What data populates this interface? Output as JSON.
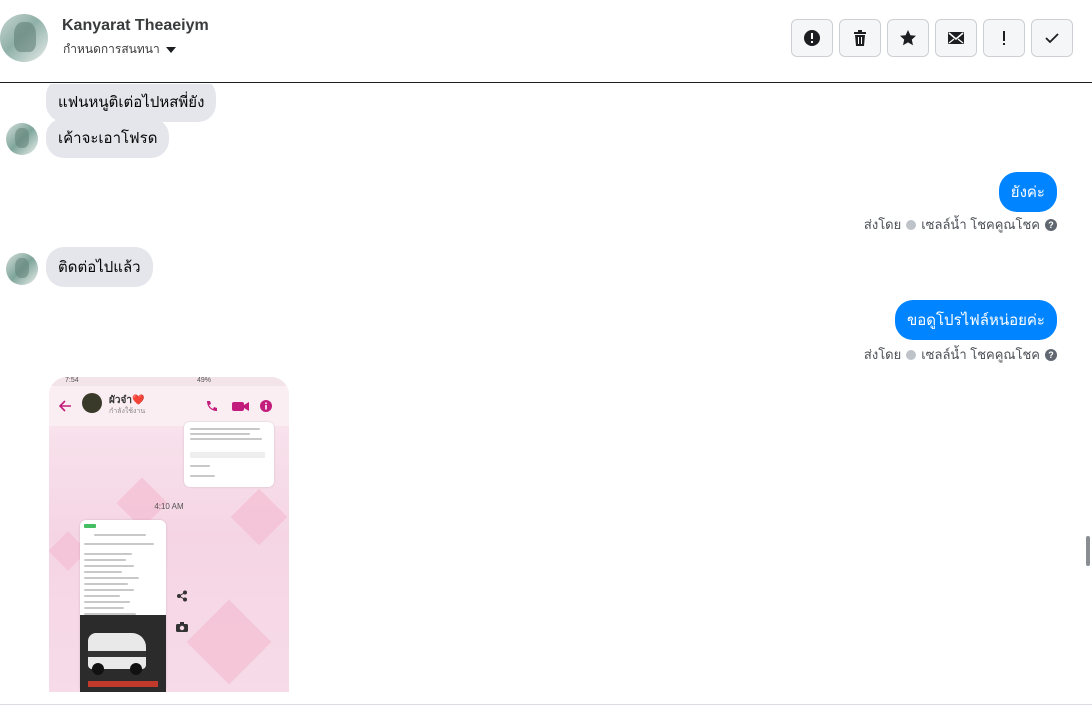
{
  "header": {
    "contact_name": "Kanyarat Theaeiym",
    "settings_label": "กำหนดการสนทนา",
    "actions": [
      {
        "name": "mark-spam-button",
        "icon": "alert-circle-icon"
      },
      {
        "name": "delete-button",
        "icon": "trash-icon"
      },
      {
        "name": "star-button",
        "icon": "star-icon"
      },
      {
        "name": "mark-unread-button",
        "icon": "envelope-icon"
      },
      {
        "name": "mark-important-button",
        "icon": "exclamation-icon"
      },
      {
        "name": "mark-done-button",
        "icon": "checkmark-icon"
      }
    ]
  },
  "messages": {
    "m1": "แฟนหนูติเต่อไปหสพี่ยัง",
    "m2": "เค้าจะเอาโฟรด",
    "m3": "ยังค่ะ",
    "m4": "ติดต่อไปแล้ว",
    "m5": "ขอดูโปรไฟล์หน่อยค่ะ",
    "sent_by_prefix": "ส่งโดย",
    "sent_by_name": "เซลล์น้ำ โชคคูณโชค"
  },
  "image_message": {
    "status_time": "7:54",
    "status_battery": "49%",
    "chat_name": "ผัวจ๋า❤️",
    "chat_status": "กำลังใช้งาน",
    "timestamp": "4:10 AM"
  },
  "colors": {
    "outgoing_bubble": "#0084ff",
    "incoming_bubble": "#e4e6eb"
  }
}
